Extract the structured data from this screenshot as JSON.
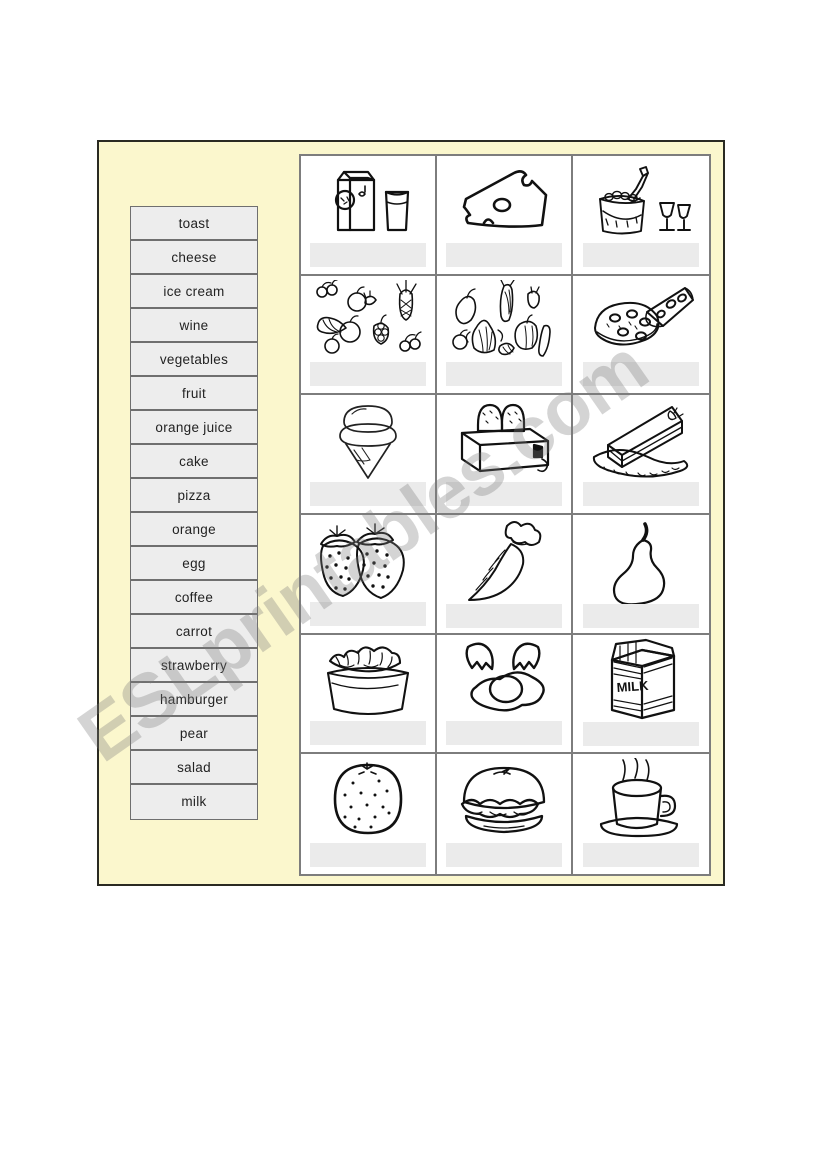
{
  "worksheet": {
    "background_color": "#fbf7cd",
    "border_color": "#2a2a22",
    "watermark_text": "ESLprintables.com"
  },
  "word_bank": {
    "items": [
      {
        "label": "toast"
      },
      {
        "label": "cheese"
      },
      {
        "label": "ice cream"
      },
      {
        "label": "wine"
      },
      {
        "label": "vegetables"
      },
      {
        "label": "fruit"
      },
      {
        "label": "orange juice"
      },
      {
        "label": "cake"
      },
      {
        "label": "pizza"
      },
      {
        "label": "orange"
      },
      {
        "label": "egg"
      },
      {
        "label": "coffee"
      },
      {
        "label": "carrot"
      },
      {
        "label": "strawberry"
      },
      {
        "label": "hamburger"
      },
      {
        "label": "pear"
      },
      {
        "label": "salad"
      },
      {
        "label": "milk"
      }
    ]
  },
  "picture_grid": {
    "columns": 3,
    "rows": 6,
    "blank_color": "#ebebeb",
    "cells": [
      {
        "icon": "orange-juice-carton-and-glass-icon",
        "answer": ""
      },
      {
        "icon": "cheese-wedge-icon",
        "answer": ""
      },
      {
        "icon": "wine-bottle-in-ice-bucket-with-glasses-icon",
        "answer": ""
      },
      {
        "icon": "assorted-fruit-icon",
        "answer": ""
      },
      {
        "icon": "assorted-vegetables-icon",
        "answer": ""
      },
      {
        "icon": "pizza-with-slice-icon",
        "answer": ""
      },
      {
        "icon": "ice-cream-cone-icon",
        "answer": ""
      },
      {
        "icon": "toaster-with-toast-icon",
        "answer": ""
      },
      {
        "icon": "cake-slice-on-plate-icon",
        "answer": ""
      },
      {
        "icon": "strawberries-icon",
        "answer": ""
      },
      {
        "icon": "carrot-icon",
        "answer": ""
      },
      {
        "icon": "pear-icon",
        "answer": ""
      },
      {
        "icon": "salad-bowl-icon",
        "answer": ""
      },
      {
        "icon": "egg-with-cracked-shell-icon",
        "answer": ""
      },
      {
        "icon": "milk-carton-icon",
        "answer": ""
      },
      {
        "icon": "orange-fruit-icon",
        "answer": ""
      },
      {
        "icon": "hamburger-icon",
        "answer": ""
      },
      {
        "icon": "coffee-cup-on-saucer-icon",
        "answer": ""
      }
    ]
  }
}
